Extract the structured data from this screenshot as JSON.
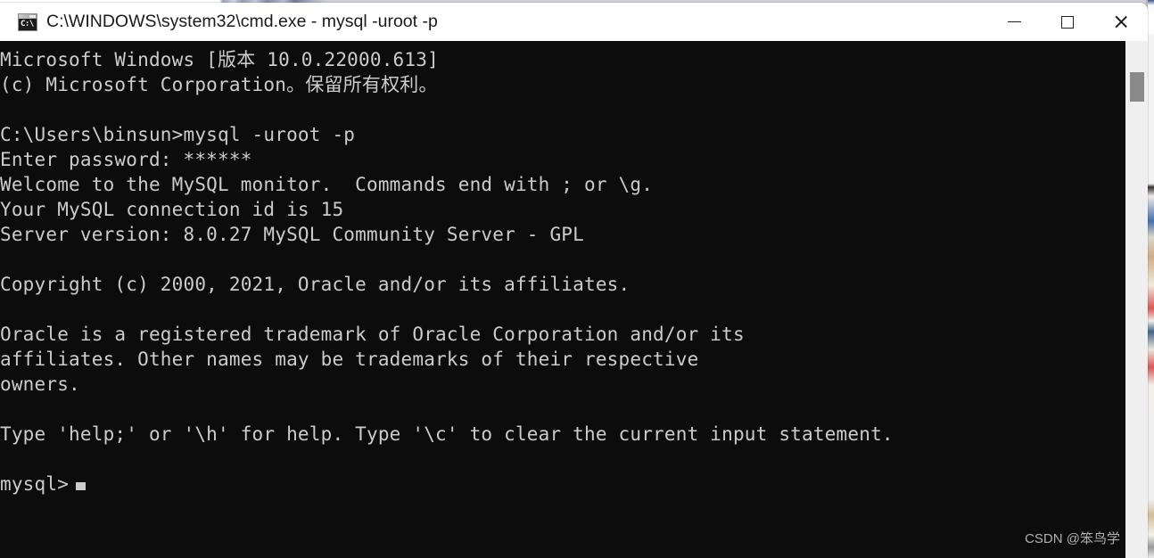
{
  "window": {
    "title": "C:\\WINDOWS\\system32\\cmd.exe - mysql  -uroot -p",
    "icon_text": "C:\\",
    "controls": {
      "minimize_label": "Minimize",
      "maximize_label": "Maximize",
      "close_label": "Close"
    },
    "colors": {
      "titlebar_bg": "#ffffff",
      "titlebar_fg": "#1a1a1a",
      "console_bg": "#0c0c0c",
      "console_fg": "#cccccc",
      "scrollbar_track": "#efefef",
      "scrollbar_thumb": "#8a8a8a"
    }
  },
  "terminal": {
    "prompt": "mysql>",
    "cursor": "block",
    "lines": [
      "Microsoft Windows [版本 10.0.22000.613]",
      "(c) Microsoft Corporation。保留所有权利。",
      "",
      "C:\\Users\\binsun>mysql -uroot -p",
      "Enter password: ******",
      "Welcome to the MySQL monitor.  Commands end with ; or \\g.",
      "Your MySQL connection id is 15",
      "Server version: 8.0.27 MySQL Community Server - GPL",
      "",
      "Copyright (c) 2000, 2021, Oracle and/or its affiliates.",
      "",
      "Oracle is a registered trademark of Oracle Corporation and/or its",
      "affiliates. Other names may be trademarks of their respective",
      "owners.",
      "",
      "Type 'help;' or '\\h' for help. Type '\\c' to clear the current input statement.",
      ""
    ]
  },
  "watermark": {
    "text": "CSDN @笨鸟学"
  }
}
